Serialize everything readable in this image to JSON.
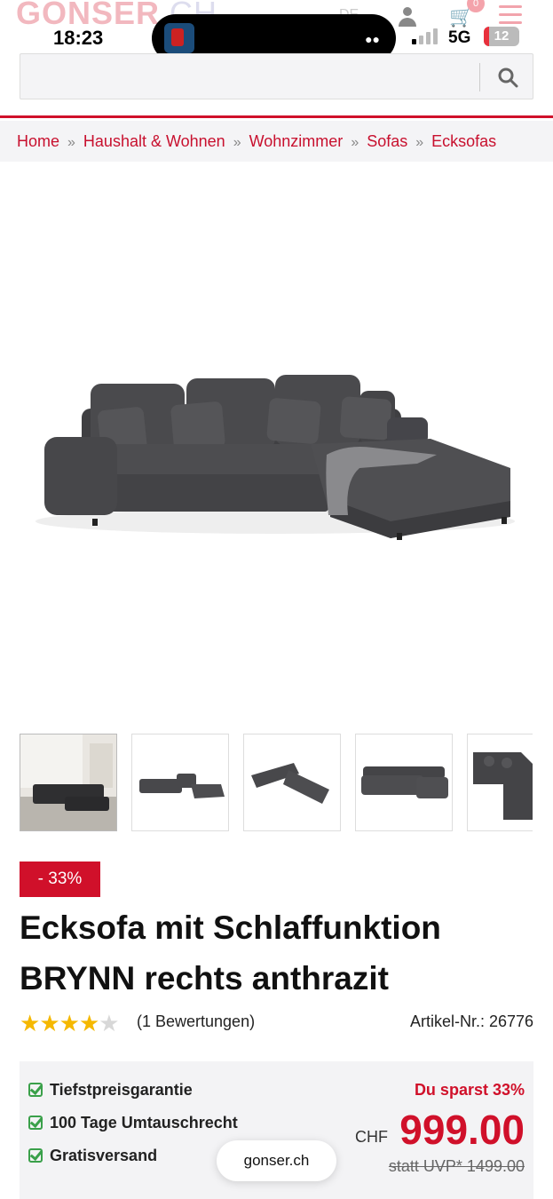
{
  "status_bar": {
    "time": "18:23",
    "network": "5G",
    "battery": "12"
  },
  "header": {
    "logo": "GONSER",
    "logo_domain": ".CH",
    "language": "DE",
    "cart_count": "0",
    "search": {
      "placeholder": "",
      "value": ""
    }
  },
  "breadcrumb": [
    "Home",
    "Haushalt & Wohnen",
    "Wohnzimmer",
    "Sofas",
    "Ecksofas"
  ],
  "breadcrumb_separator": "»",
  "product": {
    "discount_badge": "- 33%",
    "title": "Ecksofa mit Schlaffunktion BRYNN rechts anthrazit",
    "rating": 4,
    "rating_max": 5,
    "reviews": "(1 Bewertungen)",
    "article_no": "Artikel-Nr.: 26776",
    "usps": [
      "Tiefstpreisgarantie",
      "100 Tage Umtauschrecht",
      "Gratisversand"
    ],
    "savings": "Du sparst 33%",
    "currency": "CHF",
    "price": "999.00",
    "uvp": "statt UVP* 1499.00"
  },
  "browser": {
    "url": "gonser.ch"
  },
  "colors": {
    "brand_red": "#d0102a",
    "sofa_grey": "#4a4a4c",
    "check_green": "#3aa04a",
    "star_gold": "#f5b800"
  }
}
